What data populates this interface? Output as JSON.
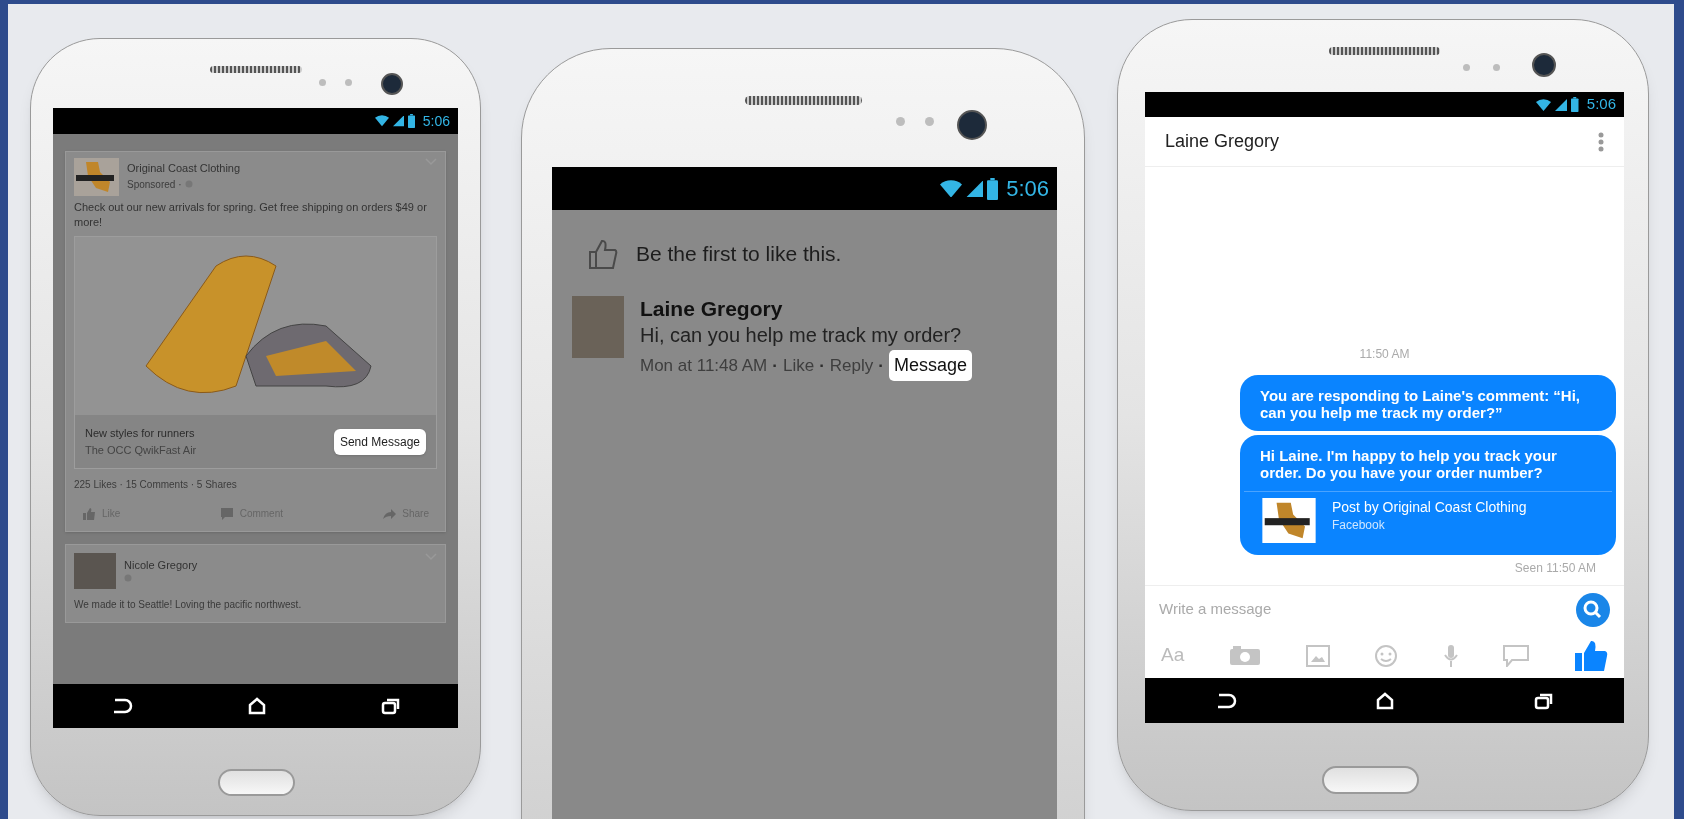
{
  "feed_phone": {
    "status_bar": {
      "time": "5:06"
    },
    "ad_post": {
      "page_name": "Original Coast Clothing",
      "meta": "Sponsored ·",
      "text": "Check out our new arrivals for spring. Get free shipping on orders $49 or more!",
      "link_title": "New styles for runners",
      "link_subtitle": "The OCC QwikFast Air",
      "cta": "Send Message",
      "stats": "225 Likes · 15 Comments · 5 Shares",
      "actions": [
        "Like",
        "Comment",
        "Share"
      ]
    },
    "friend_post": {
      "author": "Nicole Gregory",
      "text": "We made it to Seattle! Loving the pacific northwest."
    }
  },
  "comment_phone": {
    "status_bar": {
      "time": "5:06"
    },
    "likes_text": "Be the first to like this.",
    "comment": {
      "author": "Laine Gregory",
      "text": "Hi, can you help me track my order?",
      "time": "Mon at 11:48 AM",
      "separator": "·",
      "actions": [
        {
          "label": "Like",
          "selected": false
        },
        {
          "label": "Reply",
          "selected": false
        },
        {
          "label": "Message",
          "selected": true
        }
      ]
    }
  },
  "chat_phone": {
    "status_bar": {
      "time": "5:06"
    },
    "title": "Laine Gregory",
    "timestamp": "11:50 AM",
    "messages": [
      {
        "text": "You are responding to Laine's comment: “Hi, can you help me track my order?”"
      },
      {
        "text": "Hi Laine. I'm happy to help you track your order. Do you have your order number?",
        "attachment": {
          "title": "Post by Original Coast Clothing",
          "source": "Facebook"
        }
      }
    ],
    "seen": "Seen 11:50 AM",
    "composer": {
      "placeholder": "Write a message"
    },
    "text_format_label": "Aa"
  }
}
